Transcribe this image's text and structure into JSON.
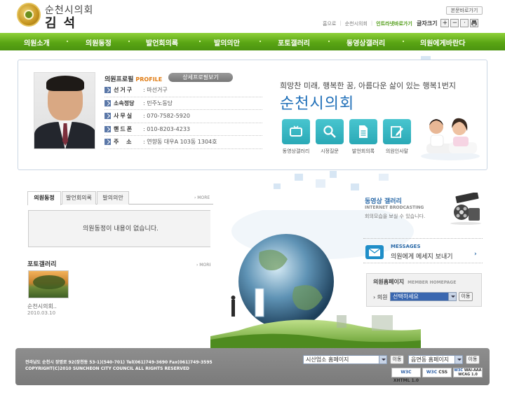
{
  "header": {
    "site_name": "순천시의회",
    "member_name": "김석",
    "skip_link": "본문바로가기",
    "util_links": [
      "홈으로",
      "순천시의회",
      "인트라넷바로가기"
    ],
    "font_size_label": "글자크기",
    "font_plus": "+",
    "font_minus": "−",
    "font_reset": "·"
  },
  "nav": {
    "items": [
      "의원소개",
      "의원동정",
      "발언회의록",
      "발의의안",
      "포토갤러리",
      "동영상갤러리",
      "의원에게바란다"
    ]
  },
  "profile": {
    "title": "의원프로필",
    "title_en": "PROFILE",
    "detail_button": "상세프로필보기",
    "rows": [
      {
        "key": "선거구",
        "value": ": 마선거구"
      },
      {
        "key": "소속정당",
        "value": ": 민주노동당"
      },
      {
        "key": "사무실",
        "value": ": 070-7582-5920"
      },
      {
        "key": "핸드폰",
        "value": ": 010-8203-4233"
      },
      {
        "key": "주 소",
        "value": ": 연향동 대우A 103동 1304호"
      }
    ]
  },
  "banner": {
    "slogan": "희망찬 미래, 행복한 꿈, 아름다운 삶이 있는 행복1번지",
    "city_title": "순천시의회",
    "quick_links": [
      "동영상갤러리",
      "시정질문",
      "발언회의록",
      "의원인사말"
    ]
  },
  "tabs": {
    "items": [
      "의원동정",
      "발언회의록",
      "발의의안"
    ],
    "more": "› MORE",
    "empty_message": "의원동정이 내용이 없습니다."
  },
  "gallery": {
    "title": "포토갤러리",
    "more": "› MORE",
    "caption": "순천시의회..",
    "date": "2010.03.10"
  },
  "video": {
    "title": "동영상 갤러리",
    "subtitle": "INTERNET BRODCASTING",
    "desc": "회의모습을 보실 수 있습니다."
  },
  "messages": {
    "title_en": "MESSAGES",
    "title_ko": "의원에게 메세지 보내기",
    "arrow": "›"
  },
  "member_homepage": {
    "title": "의원홈페이지",
    "title_en": "MEMBER HOMEPAGE",
    "label": "› 의원",
    "select_value": "선택하세요",
    "go_button": "이동"
  },
  "footer": {
    "address": "전라남도 순천시 장명로 92(장천동 53-1)(540-701)  Tel(061)749-3690  Fax(061)749-3595",
    "copyright": "COPYRIGHT(C)2010 SUNCHEON CITY COUNCIL  ALL RIGHTS RESERVED",
    "select1": "시산업소 홈페이지",
    "select2": "읍면동 홈페이지",
    "go_button": "이동",
    "badges": [
      {
        "w3c": "W3C",
        "label": "XHTML 1.0"
      },
      {
        "w3c": "W3C",
        "label": "CSS"
      },
      {
        "w3c": "W3C",
        "label": "WAI-AAA WCAG 1.0"
      }
    ]
  },
  "colors": {
    "nav_green": "#5aa514",
    "accent_blue": "#1f6fb8",
    "icon_teal": "#2aa9b6",
    "footer_gray": "#7a7a7a"
  }
}
